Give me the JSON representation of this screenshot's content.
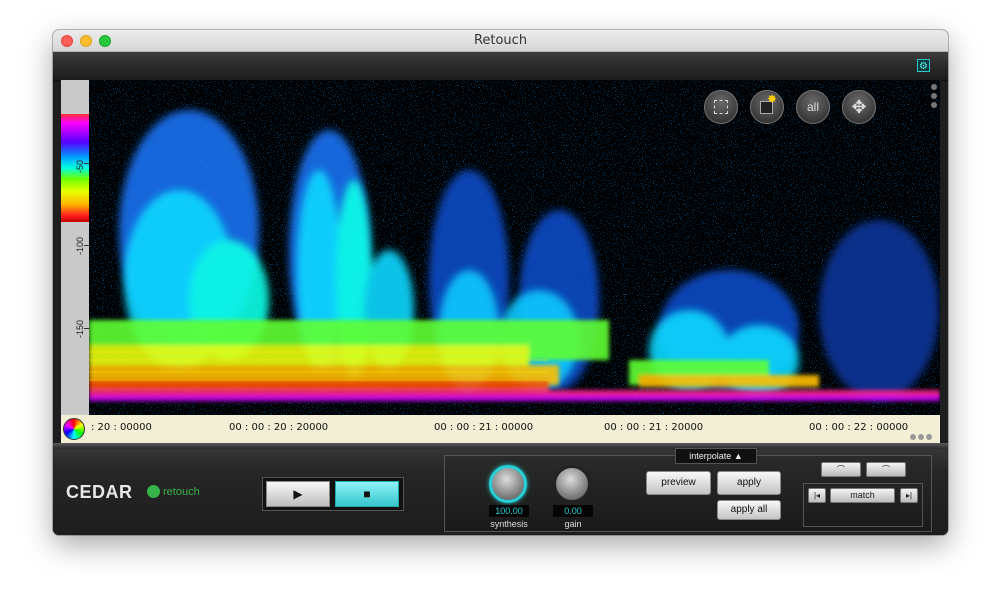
{
  "window": {
    "title": "Retouch"
  },
  "scale": {
    "ticks": [
      "-50",
      "-100",
      "-150"
    ]
  },
  "tools": {
    "all_label": "all"
  },
  "timeline": {
    "labels": [
      ": 20 : 00000",
      "00 : 00 : 20 : 20000",
      "00 : 00 : 21 : 00000",
      "00 : 00 : 21 : 20000",
      "00 : 00 : 22 : 00000"
    ]
  },
  "brand": {
    "name": "CEDAR",
    "product": "retouch"
  },
  "transport": {
    "play_icon": "▶",
    "stop_icon": "■"
  },
  "controls": {
    "mode": "interpolate",
    "synthesis_value": "100.00",
    "synthesis_label": "synthesis",
    "gain_value": "0.00",
    "gain_label": "gain",
    "preview_label": "preview",
    "apply_label": "apply",
    "apply_all_label": "apply all",
    "match_label": "match"
  },
  "colors": {
    "accent": "#25d0d6",
    "brand_green": "#38b24a"
  }
}
